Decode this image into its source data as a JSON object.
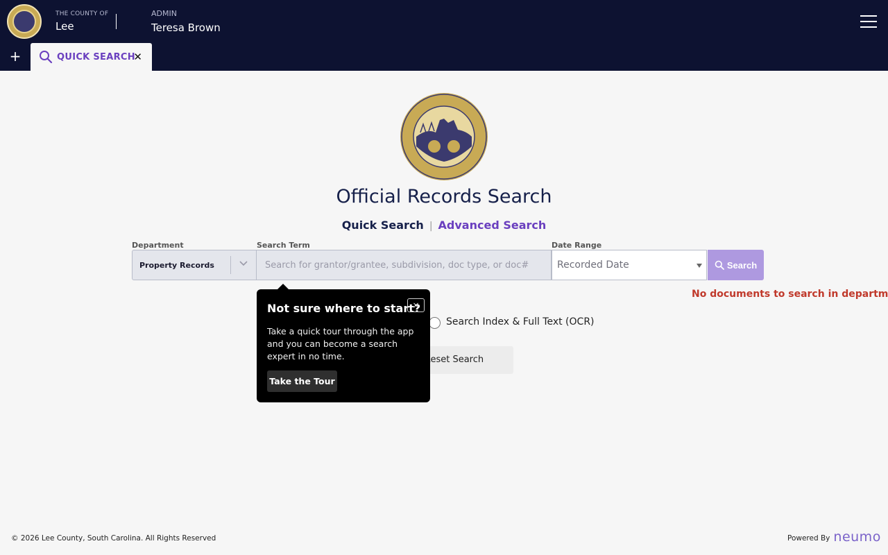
{
  "header": {
    "county_prefix": "THE COUNTY OF",
    "county_name": "Lee",
    "user_role": "ADMIN",
    "user_name": "Teresa Brown",
    "bg_color": "#0d1231"
  },
  "tabs": [
    {
      "label": "QUICK SEARCH",
      "active": true
    }
  ],
  "main": {
    "title": "Official Records Search",
    "mode_quick": "Quick Search",
    "mode_advanced": "Advanced Search",
    "department_label": "Department",
    "department_value": "Property Records",
    "search_label": "Search Term",
    "search_placeholder": "Search for grantor/grantee, subdivision, doc type, or doc#",
    "date_label": "Date Range",
    "date_value": "Recorded Date",
    "search_button": "Search",
    "error": "No documents to search in department.",
    "ocr_option": "Search Index & Full Text (OCR)",
    "reset_button": "Reset Search",
    "accent_color": "#6a3fbf",
    "error_color": "#c0392b"
  },
  "tour": {
    "title": "Not sure where to start?",
    "close": "×",
    "text": "Take a quick tour through the app and you can become a search expert in no time.",
    "button": "Take the Tour"
  },
  "footer": {
    "copyright": "© 2026 Lee County, South Carolina. All Rights Reserved",
    "powered_by": "Powered By",
    "brand": "neumo"
  }
}
